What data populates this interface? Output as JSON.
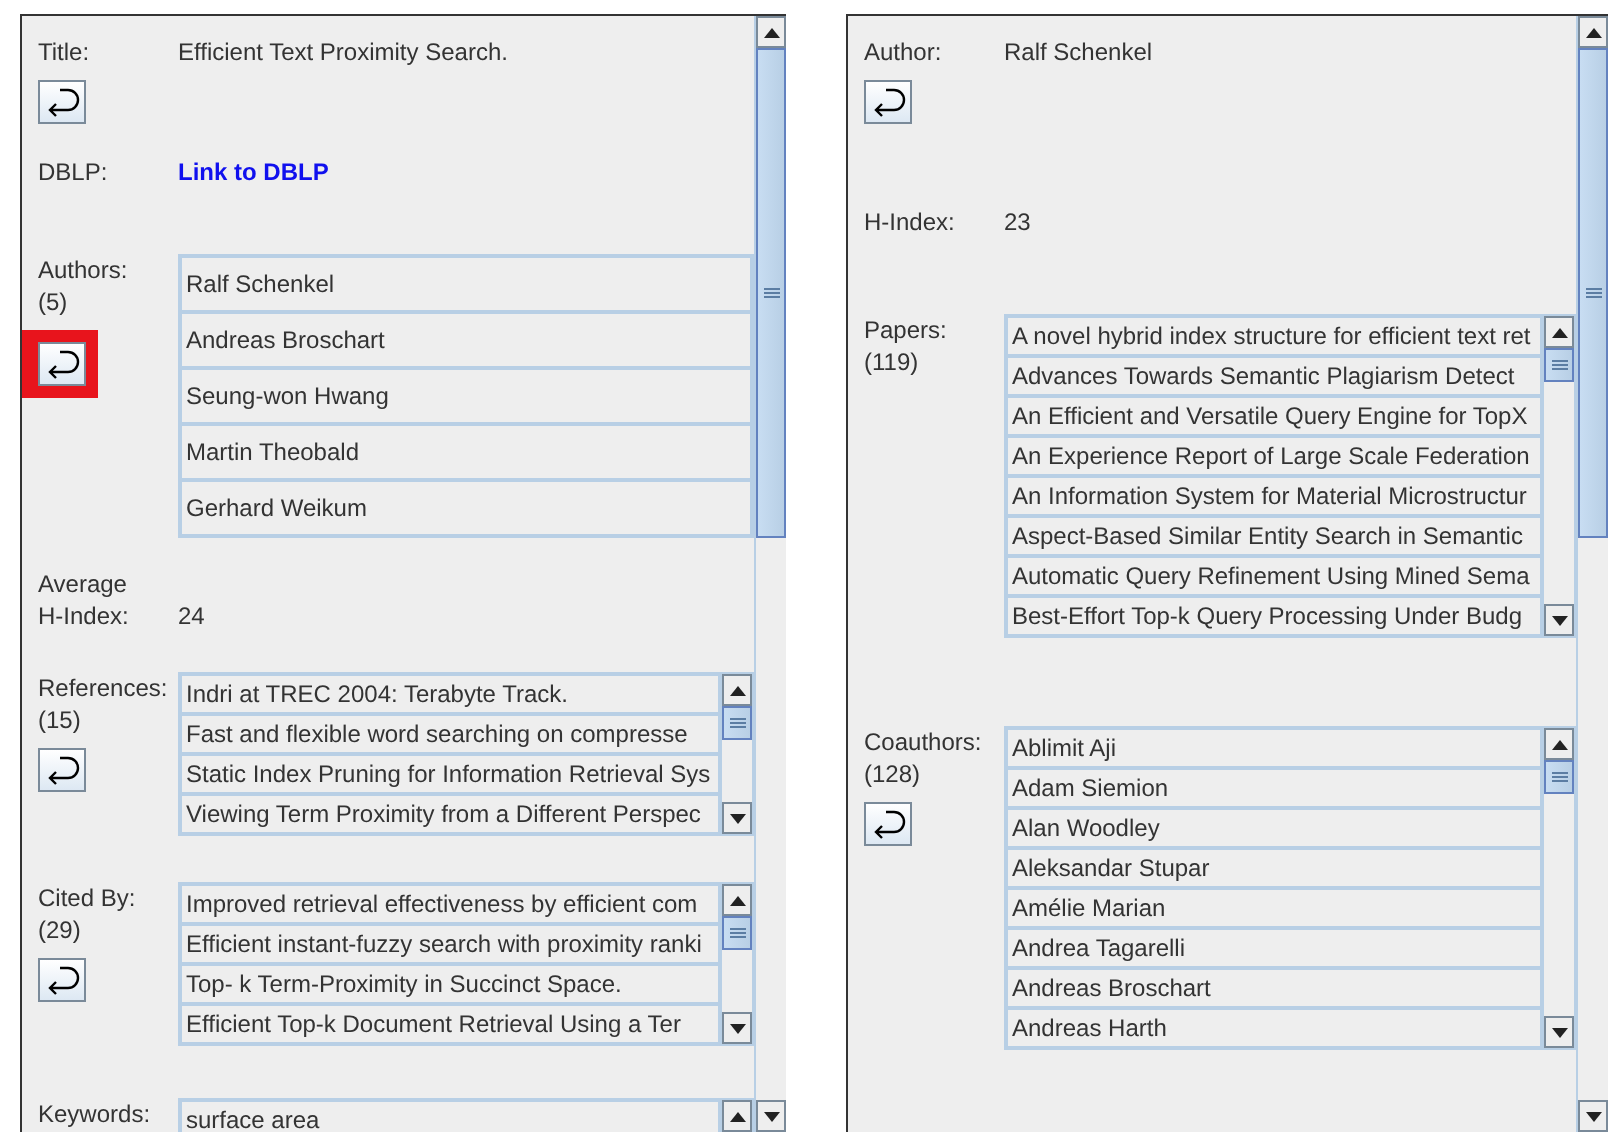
{
  "panels": [
    {
      "sections": [
        {
          "kind": "text",
          "label": "Title:",
          "value": "Efficient Text Proximity Search.",
          "back": {
            "highlighted": false
          }
        },
        {
          "kind": "link",
          "label": "DBLP:",
          "value": "Link to DBLP"
        },
        {
          "kind": "list",
          "label": "Authors:",
          "count": "(5)",
          "back": {
            "highlighted": true
          },
          "scroll": false,
          "items": [
            "Ralf Schenkel",
            "Andreas Broschart",
            "Seung-won Hwang",
            "Martin Theobald",
            "Gerhard Weikum"
          ]
        },
        {
          "kind": "text",
          "label": "Average H-Index:",
          "value": "24"
        },
        {
          "kind": "list",
          "label": "References:",
          "count": "(15)",
          "back": {
            "highlighted": false
          },
          "scroll": true,
          "items": [
            "Indri at TREC 2004: Terabyte Track.",
            "Fast and flexible word searching on compresse",
            "Static Index Pruning for Information Retrieval Sys",
            "Viewing Term Proximity from a Different Perspec"
          ]
        },
        {
          "kind": "list",
          "label": "Cited By:",
          "count": "(29)",
          "back": {
            "highlighted": false
          },
          "scroll": true,
          "items": [
            "Improved retrieval effectiveness by efficient com",
            "Efficient instant-fuzzy search with proximity ranki",
            "Top- k Term-Proximity in Succinct Space.",
            "Efficient Top-k Document Retrieval Using a Ter"
          ]
        },
        {
          "kind": "list",
          "label": "Keywords:",
          "scroll": true,
          "items": [
            "surface area"
          ]
        }
      ]
    },
    {
      "sections": [
        {
          "kind": "text",
          "label": "Author:",
          "value": "Ralf Schenkel",
          "back": {
            "highlighted": false
          }
        },
        {
          "kind": "text",
          "label": "H-Index:",
          "value": "23"
        },
        {
          "kind": "list",
          "label": "Papers:",
          "count": "(119)",
          "scroll": true,
          "items": [
            "A novel hybrid index structure for efficient text ret",
            "Advances Towards Semantic Plagiarism Detect",
            "An Efficient and Versatile Query Engine for TopX",
            "An Experience Report of Large Scale Federation",
            "An Information System for Material Microstructur",
            "Aspect-Based Similar Entity Search in Semantic",
            "Automatic Query Refinement Using Mined Sema",
            "Best-Effort Top-k Query Processing Under Budg"
          ]
        },
        {
          "kind": "list",
          "label": "Coauthors:",
          "count": "(128)",
          "back": {
            "highlighted": false
          },
          "scroll": true,
          "items": [
            "Ablimit Aji",
            "Adam Siemion",
            "Alan Woodley",
            "Aleksandar Stupar",
            "Amélie Marian",
            "Andrea Tagarelli",
            "Andreas Broschart",
            "Andreas Harth"
          ]
        }
      ]
    }
  ]
}
